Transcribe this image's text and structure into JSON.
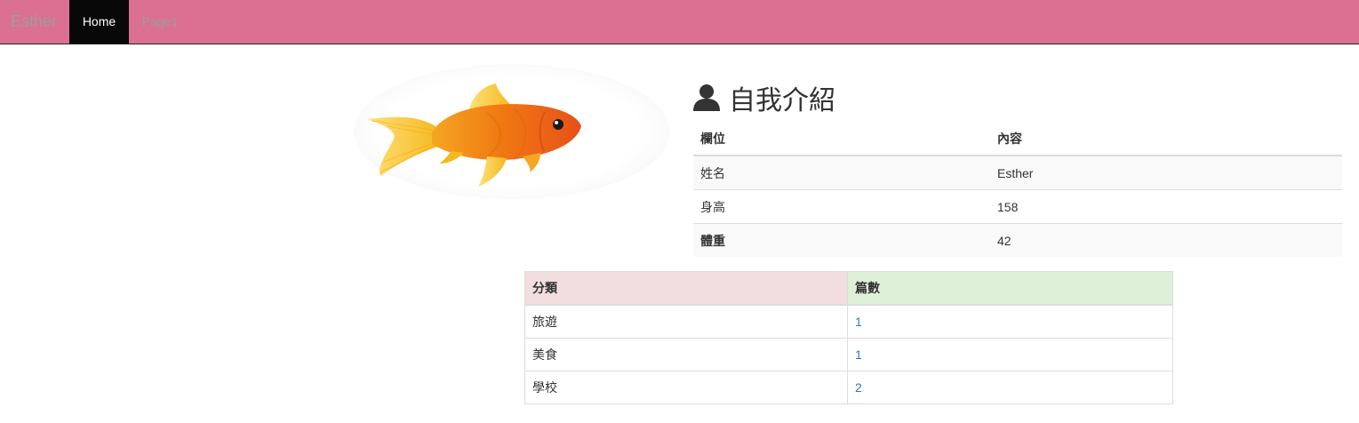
{
  "navbar": {
    "brand": "Esther",
    "items": [
      {
        "label": "Home",
        "active": true
      },
      {
        "label": "Page1",
        "active": false
      }
    ],
    "background_color": "#db7093",
    "active_color": "#080808"
  },
  "intro": {
    "icon": "user-icon",
    "title": "自我介紹",
    "headers": [
      "欄位",
      "內容"
    ],
    "rows": [
      {
        "field": "姓名",
        "value": "Esther"
      },
      {
        "field": "身高",
        "value": "158"
      },
      {
        "field": "體重",
        "value": "42"
      }
    ]
  },
  "categories": {
    "headers": [
      "分類",
      "篇數"
    ],
    "rows": [
      {
        "name": "旅遊",
        "count": "1"
      },
      {
        "name": "美食",
        "count": "1"
      },
      {
        "name": "學校",
        "count": "2"
      }
    ],
    "header_colors": {
      "danger": "#f2dede",
      "success": "#dff0d8"
    },
    "link_color": "#337ab7"
  },
  "image": {
    "icon": "goldfish-image"
  }
}
